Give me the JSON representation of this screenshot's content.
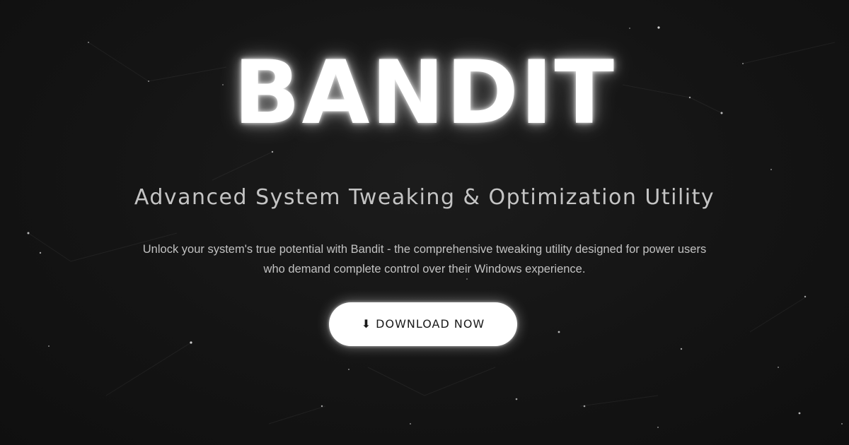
{
  "hero": {
    "title": "BANDIT",
    "tagline": "Advanced System Tweaking & Optimization Utility",
    "description": "Unlock your system's true potential with Bandit - the comprehensive tweaking utility designed for power users who demand complete control over their Windows experience.",
    "cta": {
      "icon": "download-arrow-icon",
      "icon_glyph": "⬇",
      "label": "DOWNLOAD NOW"
    }
  },
  "colors": {
    "background": "#141414",
    "title": "#ffffff",
    "tagline": "#c4c4c4",
    "description": "#c2c2c2",
    "button_bg": "#ffffff",
    "button_text": "#1a1a1a"
  }
}
